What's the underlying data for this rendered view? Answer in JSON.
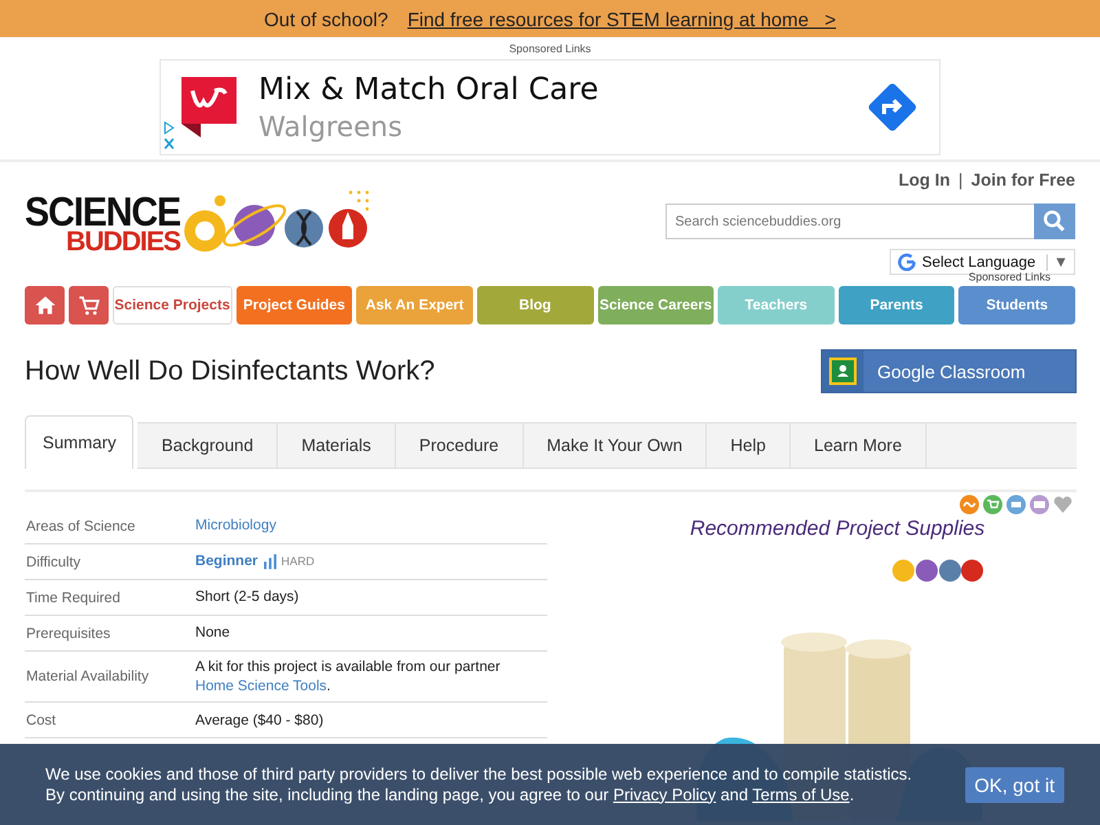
{
  "promo_bar": {
    "text": "Out of school?",
    "link": "Find free resources for STEM learning at home   >"
  },
  "ad": {
    "label": "Sponsored Links",
    "headline": "Mix & Match Oral Care",
    "advertiser": "Walgreens"
  },
  "header": {
    "logo_top": "SCIENCE",
    "logo_bottom": "BUDDIES",
    "login": "Log In",
    "separator": "|",
    "join": "Join for Free",
    "search": {
      "placeholder": "Search sciencebuddies.org"
    },
    "language": "Select Language",
    "language_caret": "▼",
    "sponsored": "Sponsored Links"
  },
  "nav": [
    {
      "kind": "home",
      "color": "#d9534f"
    },
    {
      "kind": "cart",
      "color": "#d9534f"
    },
    {
      "kind": "text",
      "label": "Science Projects",
      "color": "#c9463d",
      "selected": true
    },
    {
      "kind": "text",
      "label": "Project Guides",
      "color": "#f27020",
      "selected": false
    },
    {
      "kind": "text",
      "label": "Ask An Expert",
      "color": "#eaa23a",
      "selected": false
    },
    {
      "kind": "text",
      "label": "Blog",
      "color": "#a3a83a",
      "selected": false
    },
    {
      "kind": "text",
      "label": "Science Careers",
      "color": "#7fae5c",
      "selected": false
    },
    {
      "kind": "text",
      "label": "Teachers",
      "color": "#84cfcc",
      "selected": false
    },
    {
      "kind": "text",
      "label": "Parents",
      "color": "#3fa1c4",
      "selected": false
    },
    {
      "kind": "text",
      "label": "Students",
      "color": "#5a8ecc",
      "selected": false
    }
  ],
  "title": "How Well Do Disinfectants Work?",
  "classroom_button": "Google Classroom",
  "tabs": [
    {
      "label": "Summary",
      "selected": true
    },
    {
      "label": "Background",
      "selected": false
    },
    {
      "label": "Materials",
      "selected": false
    },
    {
      "label": "Procedure",
      "selected": false
    },
    {
      "label": "Make It Your Own",
      "selected": false
    },
    {
      "label": "Help",
      "selected": false
    },
    {
      "label": "Learn More",
      "selected": false
    }
  ],
  "share_icons": [
    {
      "kind": "rss",
      "color": "#f28a1e"
    },
    {
      "kind": "cart",
      "color": "#5cb85c"
    },
    {
      "kind": "print",
      "color": "#6aa6d8"
    },
    {
      "kind": "mail",
      "color": "#b79bd0"
    },
    {
      "kind": "heart",
      "color": "#b0b0b0"
    }
  ],
  "summary": [
    {
      "label": "Areas of Science",
      "kind": "link",
      "value": "Microbiology"
    },
    {
      "label": "Difficulty",
      "kind": "difficulty",
      "value": "Beginner",
      "extra": "HARD"
    },
    {
      "label": "Time Required",
      "kind": "text",
      "value": "Short (2-5 days)"
    },
    {
      "label": "Prerequisites",
      "kind": "text",
      "value": "None"
    },
    {
      "label": "Material Availability",
      "kind": "mixed",
      "value": "A kit for this project is available from our partner",
      "link": "Home Science Tools",
      "after": "."
    },
    {
      "label": "Cost",
      "kind": "text",
      "value": "Average ($40 - $80)"
    }
  ],
  "supplies": {
    "title": "Recommended Project Supplies"
  },
  "cookie_banner": {
    "line1": "We use cookies and those of third party providers to deliver the best possible web experience and to compile statistics.",
    "line2_before": "By continuing and using the site, including the landing page, you agree to our",
    "privacy": "Privacy Policy",
    "and": "and",
    "terms": "Terms of Use",
    "end": ".",
    "button": "OK, got it"
  }
}
